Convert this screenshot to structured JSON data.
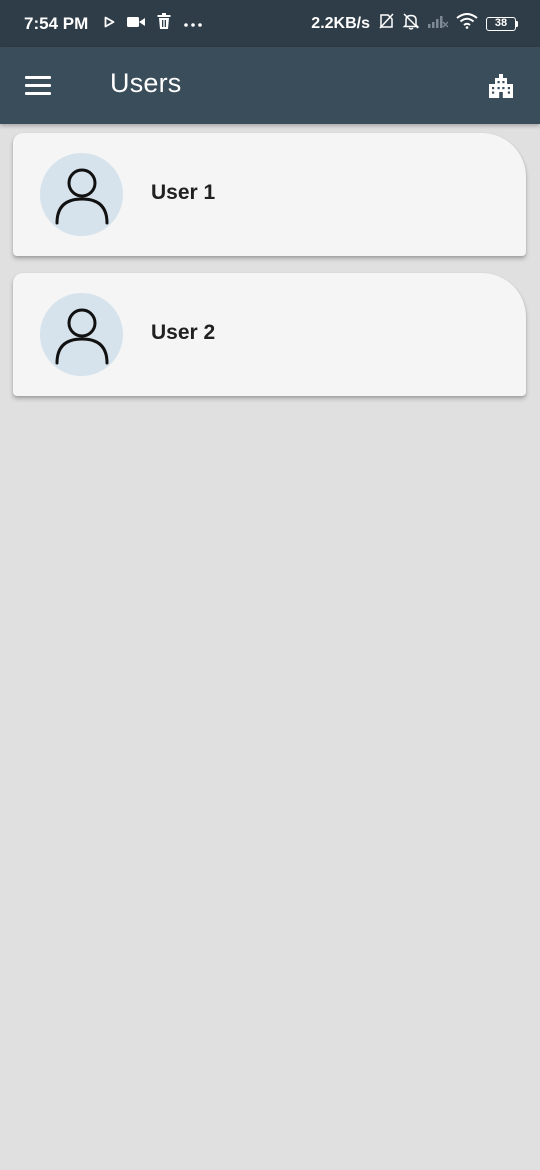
{
  "status_bar": {
    "time": "7:54 PM",
    "speed": "2.2KB/s",
    "battery": "38",
    "left_icons": [
      "play-icon",
      "video-camera-icon",
      "trash-icon",
      "more-icon"
    ],
    "right_icons": [
      "no-sim-icon",
      "notifications-off-icon",
      "signal-icon",
      "wifi-icon"
    ]
  },
  "app_bar": {
    "title": "Users",
    "menu_icon": "hamburger-menu-icon",
    "action_icon": "building-icon",
    "background": "#3a4d5a"
  },
  "users": [
    {
      "name": "User 1",
      "avatar_icon": "person-icon"
    },
    {
      "name": "User 2",
      "avatar_icon": "person-icon"
    }
  ],
  "colors": {
    "status_bar": "#2f3d48",
    "app_bar": "#3a4d5a",
    "page_background": "#e0e0e0",
    "card_background": "#f5f5f5",
    "avatar_background": "#d6e3ec"
  }
}
